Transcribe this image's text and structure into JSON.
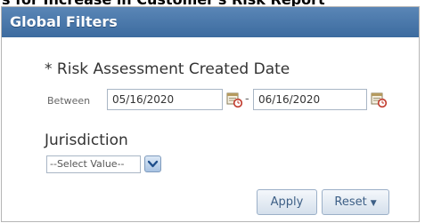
{
  "page": {
    "title": "s for Increase in Customer's Risk Report"
  },
  "panel": {
    "title": "Global Filters",
    "risk_date": {
      "label": "* Risk Assessment Created Date",
      "between_label": "Between",
      "from_value": "05/16/2020",
      "separator": "-",
      "to_value": "06/16/2020"
    },
    "jurisdiction": {
      "label": "Jurisdiction",
      "selected_value": "--Select Value--"
    },
    "buttons": {
      "apply_label": "Apply",
      "reset_label": "Reset",
      "reset_caret": "▼"
    }
  },
  "icons": {
    "calendar": "calendar-icon",
    "dropdown": "chevron-down-icon"
  },
  "colors": {
    "header_bg": "#3c6b9f",
    "button_text": "#3d5f86",
    "calendar_accent": "#c0392b"
  }
}
